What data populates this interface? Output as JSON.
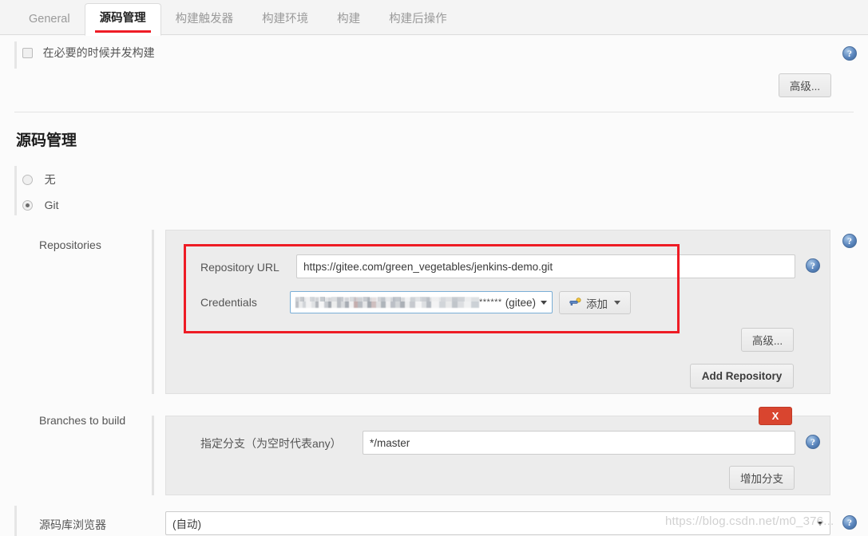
{
  "tabs": [
    {
      "label": "General",
      "active": false
    },
    {
      "label": "源码管理",
      "active": true
    },
    {
      "label": "构建触发器",
      "active": false
    },
    {
      "label": "构建环境",
      "active": false
    },
    {
      "label": "构建",
      "active": false
    },
    {
      "label": "构建后操作",
      "active": false
    }
  ],
  "concurrent": {
    "label": "在必要的时候并发构建",
    "checked": false,
    "advanced_label": "高级...",
    "help": "?"
  },
  "scm": {
    "title": "源码管理",
    "options": [
      {
        "label": "无",
        "selected": false
      },
      {
        "label": "Git",
        "selected": true
      }
    ]
  },
  "repositories": {
    "label": "Repositories",
    "help": "?",
    "repository_url": {
      "label": "Repository URL",
      "value": "https://gitee.com/green_vegetables/jenkins-demo.git",
      "help": "?"
    },
    "credentials": {
      "label": "Credentials",
      "masked_value": "******",
      "suffix": "(gitee)",
      "add_button": "添加",
      "add_icon": "key-icon"
    },
    "advanced_label": "高级...",
    "add_repository_label": "Add Repository"
  },
  "branches": {
    "label": "Branches to build",
    "help": "?",
    "delete_label": "X",
    "branch_spec": {
      "label": "指定分支（为空时代表any）",
      "value": "*/master"
    },
    "add_branch_label": "增加分支"
  },
  "browser": {
    "label": "源码库浏览器",
    "value": "(自动)",
    "help": "?"
  },
  "watermark": "https://blog.csdn.net/m0_376...",
  "colors": {
    "accent_red": "#ee1c25",
    "delete_red": "#d9452f",
    "help_blue": "#4a6f9e",
    "panel_bg": "#ececec",
    "page_bg": "#fbfbfb"
  }
}
